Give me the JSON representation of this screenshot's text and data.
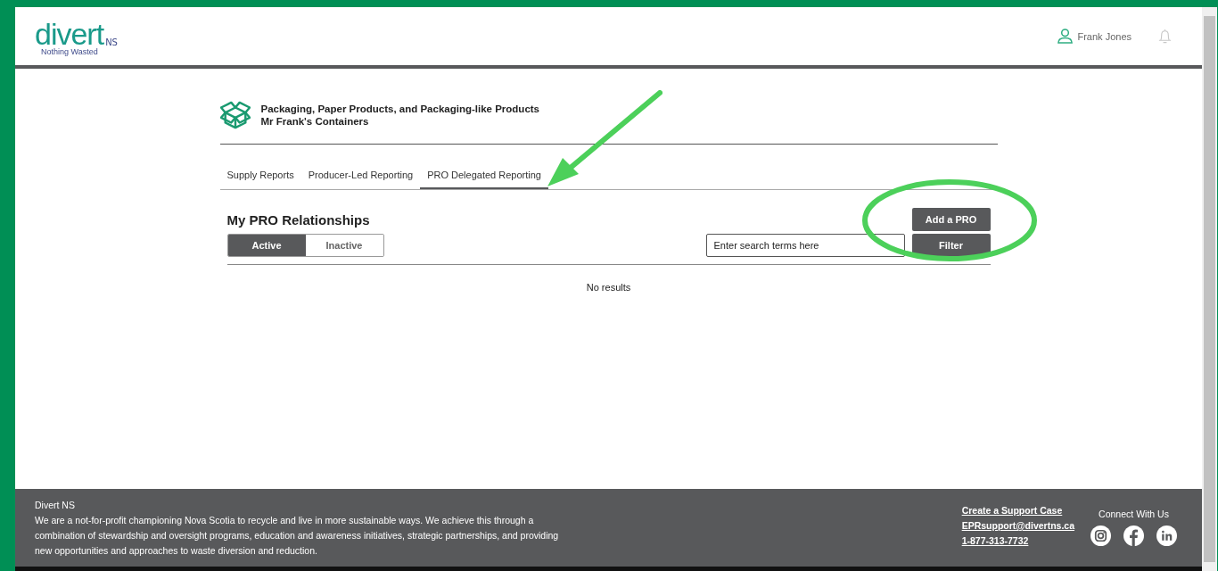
{
  "header": {
    "logo": {
      "word": "divert",
      "suffix": "NS",
      "tagline": "Nothing Wasted"
    },
    "user": "Frank Jones"
  },
  "program": {
    "title": "Packaging, Paper Products, and Packaging-like Products",
    "company": "Mr Frank's Containers"
  },
  "tabs": [
    {
      "label": "Supply Reports",
      "selected": false
    },
    {
      "label": "Producer-Led Reporting",
      "selected": false
    },
    {
      "label": "PRO Delegated Reporting",
      "selected": true
    }
  ],
  "section": {
    "title": "My PRO Relationships",
    "add_button": "Add a PRO",
    "status_toggle": [
      {
        "label": "Active",
        "selected": true
      },
      {
        "label": "Inactive",
        "selected": false
      }
    ],
    "search": {
      "placeholder": "Enter search terms here"
    },
    "filter_button": "Filter",
    "empty_message": "No results"
  },
  "footer": {
    "org": "Divert NS",
    "about": "We are a not-for-profit championing Nova Scotia to recycle and live in more sustainable ways. We achieve this through a combination of stewardship and oversight programs, education and awareness initiatives, strategic partnerships, and providing new opportunities and approaches to waste diversion and reduction.",
    "links": [
      "Create a Support Case",
      "EPRsupport@divertns.ca",
      "1-877-313-7732"
    ],
    "social_heading": "Connect With Us"
  }
}
